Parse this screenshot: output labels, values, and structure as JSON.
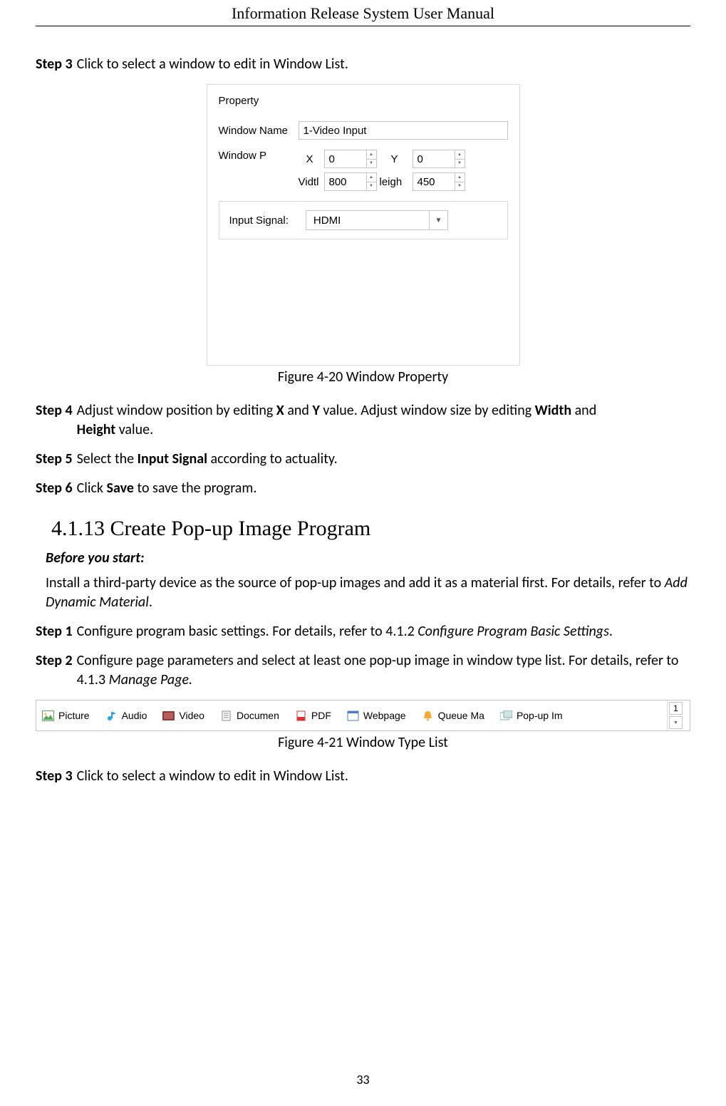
{
  "header": {
    "title": "Information Release System User Manual"
  },
  "page_number": "33",
  "steps_a": {
    "s3": {
      "label": "Step 3",
      "text": "Click to select a window to edit in Window List."
    }
  },
  "figure1": {
    "caption": "Figure 4-20 Window Property",
    "panel": {
      "title": "Property",
      "window_name_label": "Window Name",
      "window_name_value": "1-Video Input",
      "window_p_label": "Window P",
      "x_label": "X",
      "x_value": "0",
      "y_label": "Y",
      "y_value": "0",
      "width_label": "Vidtl",
      "width_value": "800",
      "height_label": "leigh",
      "height_value": "450",
      "input_signal_label": "Input Signal:",
      "input_signal_value": "HDMI"
    }
  },
  "steps_b": {
    "s4": {
      "label": "Step 4",
      "prefix": "Adjust window position by editing ",
      "x": "X",
      "and": " and ",
      "y": "Y",
      "mid": " value. Adjust window size by editing ",
      "w": "Width",
      "and2": " and ",
      "h": "Height",
      "suffix": " value."
    },
    "s5": {
      "label": "Step 5",
      "prefix": "Select the ",
      "b": "Input Signal",
      "suffix": " according to actuality."
    },
    "s6": {
      "label": "Step 6",
      "prefix": "Click ",
      "b": "Save",
      "suffix": " to save the program."
    }
  },
  "section": {
    "heading": "4.1.13 Create Pop-up Image Program",
    "before_label": "Before you start:",
    "before_text_a": "Install a third-party device as the source of pop-up images and add it as a material first. For details, refer to ",
    "before_text_i": "Add Dynamic Material",
    "before_text_b": "."
  },
  "steps_c": {
    "s1": {
      "label": "Step 1",
      "a": "Configure program basic settings. For details, refer to 4.1.2 ",
      "i": "Configure Program Basic Settings",
      "b": "."
    },
    "s2": {
      "label": "Step 2",
      "a": "Configure page parameters and select at least one pop-up image in window type list. For details, refer to 4.1.3 ",
      "i": "Manage Page.",
      "b": ""
    }
  },
  "figure2": {
    "caption": "Figure 4-21 Window Type List",
    "items": {
      "picture": "Picture",
      "audio": "Audio",
      "video": "Video",
      "document": "Documen",
      "pdf": "PDF",
      "webpage": "Webpage",
      "queue": "Queue Ma",
      "popup": "Pop-up Im"
    },
    "counter": "1"
  },
  "steps_d": {
    "s3": {
      "label": "Step 3",
      "text": "Click to select a window to edit in Window List."
    }
  }
}
